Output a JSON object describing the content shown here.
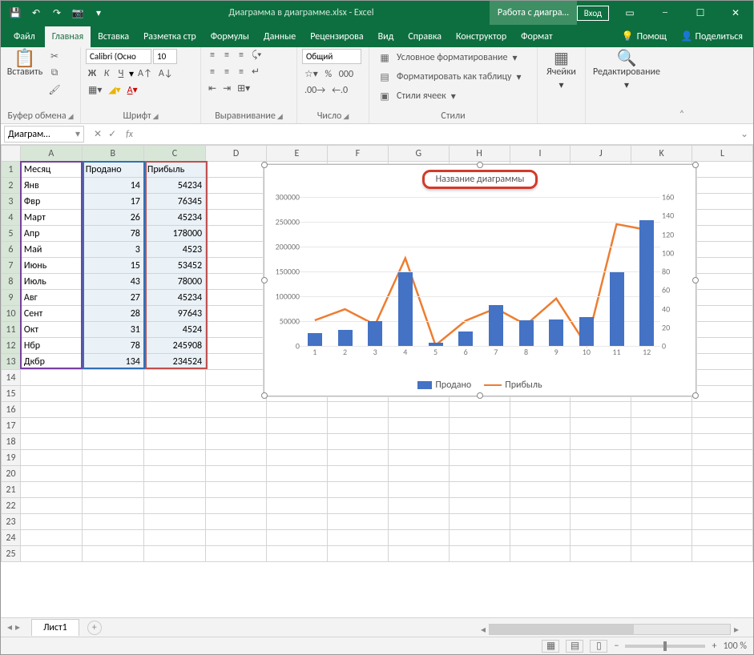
{
  "titlebar": {
    "doc_title": "Диаграмма в диаграмме.xlsx - Excel",
    "contextual_title": "Работа с диагра…",
    "login": "Вход"
  },
  "tabs": {
    "file": "Файл",
    "home": "Главная",
    "insert": "Вставка",
    "layout": "Разметка стр",
    "formulas": "Формулы",
    "data": "Данные",
    "review": "Рецензирова",
    "view": "Вид",
    "help": "Справка",
    "design": "Конструктор",
    "format": "Формат",
    "tell": "Помощ",
    "share": "Поделиться"
  },
  "ribbon": {
    "paste": "Вставить",
    "clipboard": "Буфер обмена",
    "font_name": "Calibri (Осно",
    "font_size": "10",
    "font": "Шрифт",
    "alignment": "Выравнивание",
    "num_format": "Общий",
    "number": "Число",
    "cond_fmt": "Условное форматирование",
    "as_table": "Форматировать как таблицу",
    "cell_styles": "Стили ячеек",
    "styles": "Стили",
    "cells": "Ячейки",
    "editing": "Редактирование",
    "bold": "Ж",
    "italic": "К",
    "underline": "Ч"
  },
  "namebox": "Диаграм…",
  "columns": [
    "A",
    "B",
    "C",
    "D",
    "E",
    "F",
    "G",
    "H",
    "I",
    "J",
    "K",
    "L"
  ],
  "headers": {
    "a": "Месяц",
    "b": "Продано",
    "c": "Прибыль"
  },
  "rows": [
    {
      "n": 1,
      "a": "Янв",
      "b": 14,
      "c": 54234
    },
    {
      "n": 2,
      "a": "Фвр",
      "b": 17,
      "c": 76345
    },
    {
      "n": 3,
      "a": "Март",
      "b": 26,
      "c": 45234
    },
    {
      "n": 4,
      "a": "Апр",
      "b": 78,
      "c": 178000
    },
    {
      "n": 5,
      "a": "Май",
      "b": 3,
      "c": 4523
    },
    {
      "n": 6,
      "a": "Июнь",
      "b": 15,
      "c": 53452
    },
    {
      "n": 7,
      "a": "Июль",
      "b": 43,
      "c": 78000
    },
    {
      "n": 8,
      "a": "Авг",
      "b": 27,
      "c": 45234
    },
    {
      "n": 9,
      "a": "Сент",
      "b": 28,
      "c": 97643
    },
    {
      "n": 10,
      "a": "Окт",
      "b": 31,
      "c": 4524
    },
    {
      "n": 11,
      "a": "Нбр",
      "b": 78,
      "c": 245908
    },
    {
      "n": 12,
      "a": "Дкбр",
      "b": 134,
      "c": 234524
    }
  ],
  "sheet": "Лист1",
  "zoom": "100 %",
  "chart_data": {
    "type": "combo",
    "title": "Название диаграммы",
    "x": [
      1,
      2,
      3,
      4,
      5,
      6,
      7,
      8,
      9,
      10,
      11,
      12
    ],
    "left_axis": {
      "min": 0,
      "max": 300000,
      "step": 50000,
      "series": "Прибыль"
    },
    "right_axis": {
      "min": 0,
      "max": 160,
      "step": 20,
      "series": "Продано"
    },
    "series": [
      {
        "name": "Продано",
        "type": "bar",
        "axis": "right",
        "color": "#4472c4",
        "values": [
          14,
          17,
          26,
          78,
          3,
          15,
          43,
          27,
          28,
          31,
          78,
          134
        ]
      },
      {
        "name": "Прибыль",
        "type": "line",
        "axis": "left",
        "color": "#ed7d31",
        "values": [
          54234,
          76345,
          45234,
          178000,
          4523,
          53452,
          78000,
          45234,
          97643,
          4524,
          245908,
          234524
        ]
      }
    ],
    "legend": [
      "Продано",
      "Прибыль"
    ]
  }
}
